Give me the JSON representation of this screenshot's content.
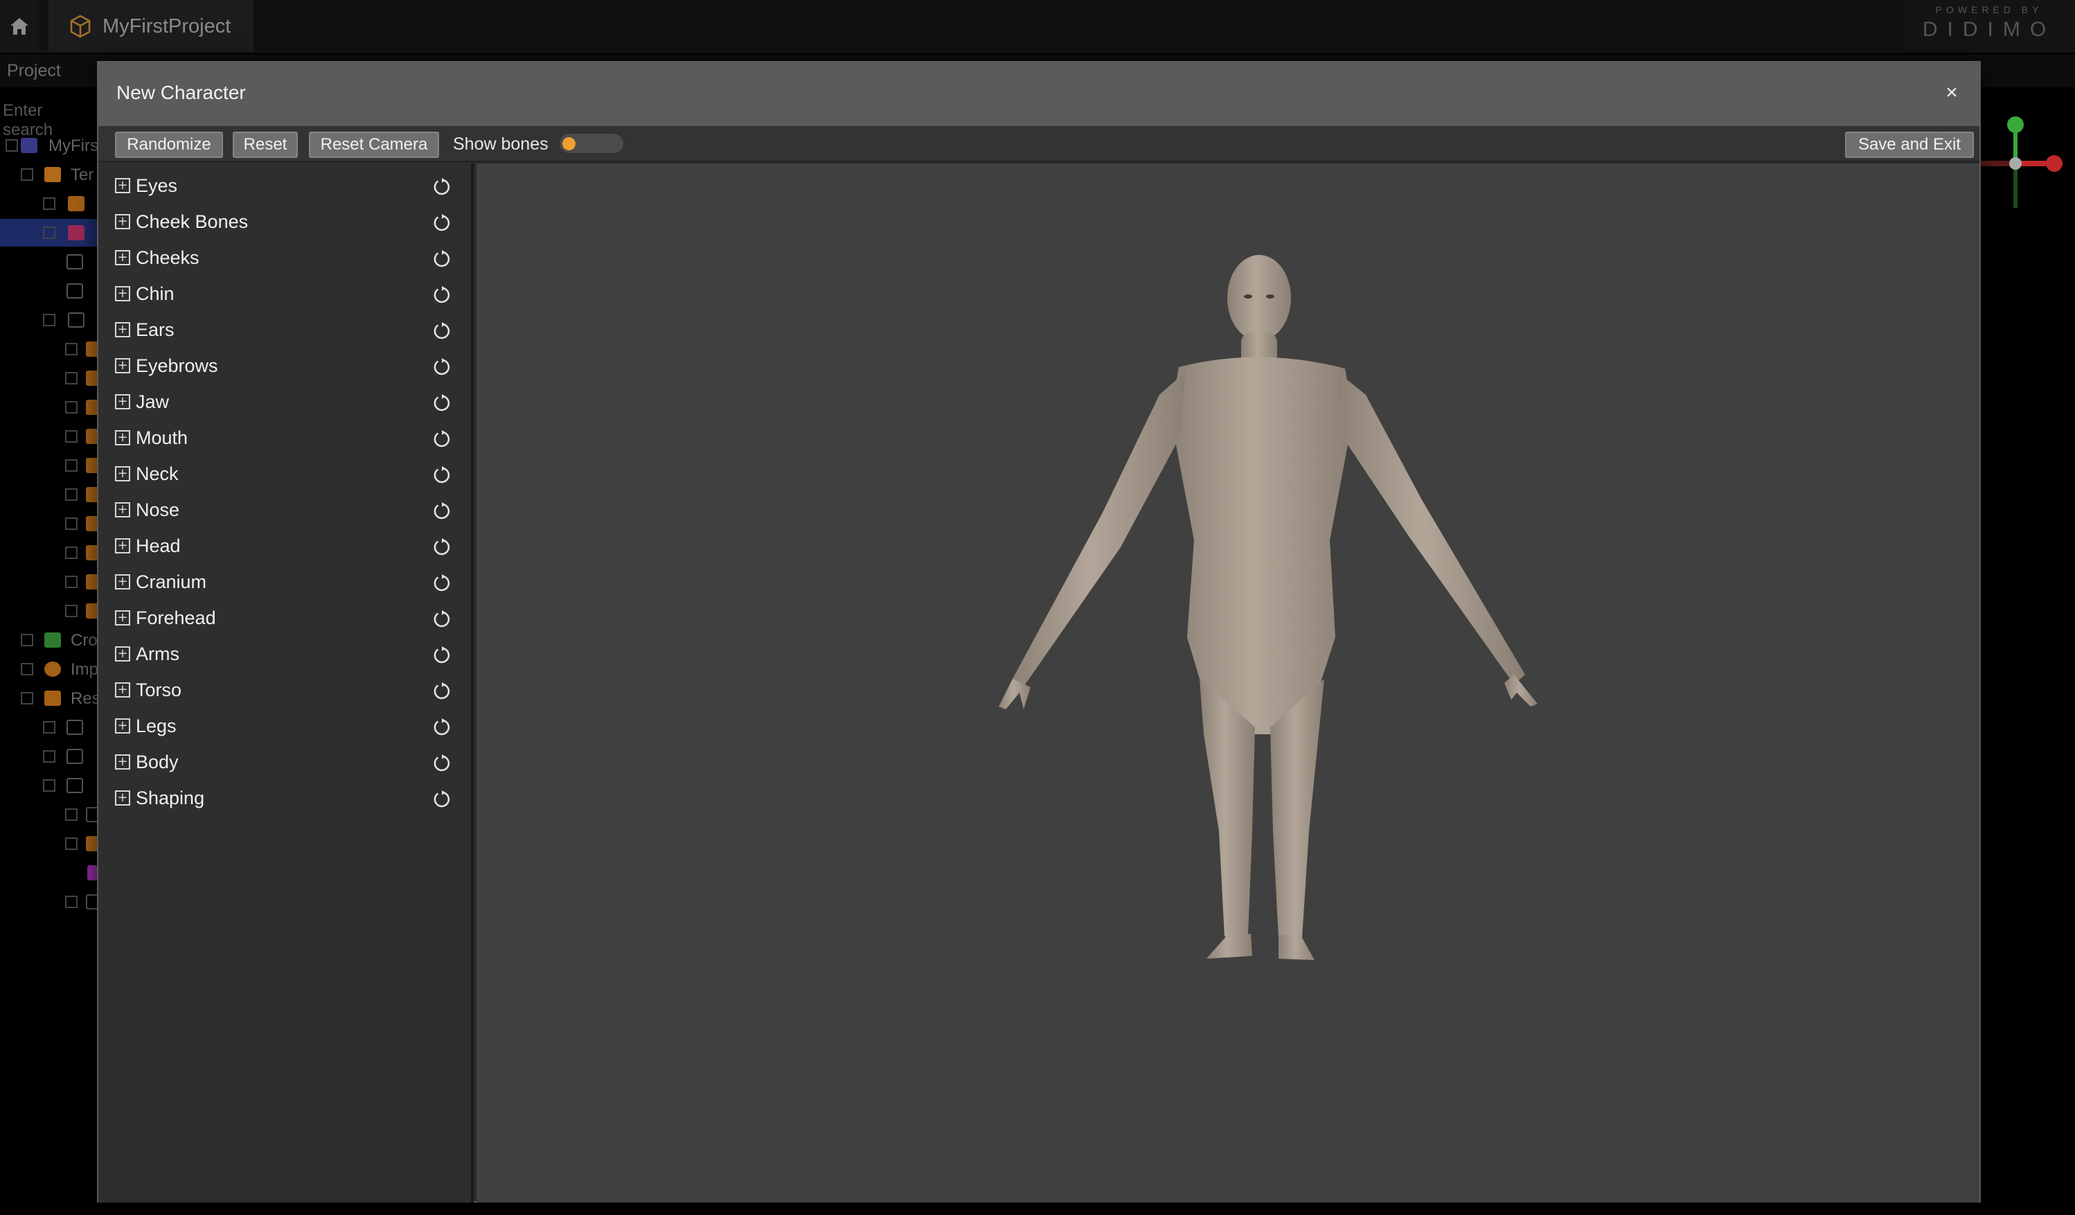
{
  "app": {
    "project_tab": "MyFirstProject",
    "powered_small": "POWERED BY",
    "powered_brand": "DIDIMO",
    "panel_title": "Project",
    "search_placeholder": "Enter search",
    "tree_items": [
      "MyFirs",
      "Ter",
      "Cro",
      "Imp",
      "Res"
    ]
  },
  "modal": {
    "title": "New Character",
    "close_symbol": "×",
    "toolbar": {
      "randomize": "Randomize",
      "reset": "Reset",
      "reset_camera": "Reset Camera",
      "show_bones_label": "Show bones",
      "show_bones_on": false,
      "save_and_exit": "Save and Exit"
    },
    "categories": [
      {
        "label": "Eyes"
      },
      {
        "label": "Cheek Bones"
      },
      {
        "label": "Cheeks"
      },
      {
        "label": "Chin"
      },
      {
        "label": "Ears"
      },
      {
        "label": "Eyebrows"
      },
      {
        "label": "Jaw"
      },
      {
        "label": "Mouth"
      },
      {
        "label": "Neck"
      },
      {
        "label": "Nose"
      },
      {
        "label": "Head"
      },
      {
        "label": "Cranium"
      },
      {
        "label": "Forehead"
      },
      {
        "label": "Arms"
      },
      {
        "label": "Torso"
      },
      {
        "label": "Legs"
      },
      {
        "label": "Body"
      },
      {
        "label": "Shaping"
      }
    ]
  },
  "colors": {
    "toggle_knob": "#f0a030",
    "gizmo_y": "#3aa83a",
    "gizmo_x": "#c0282a",
    "skin": "#a99c8e"
  },
  "icons": {
    "home": "home-icon",
    "project": "cube-icon",
    "expand": "plus-square-icon",
    "reset": "refresh-icon",
    "close": "close-icon"
  }
}
